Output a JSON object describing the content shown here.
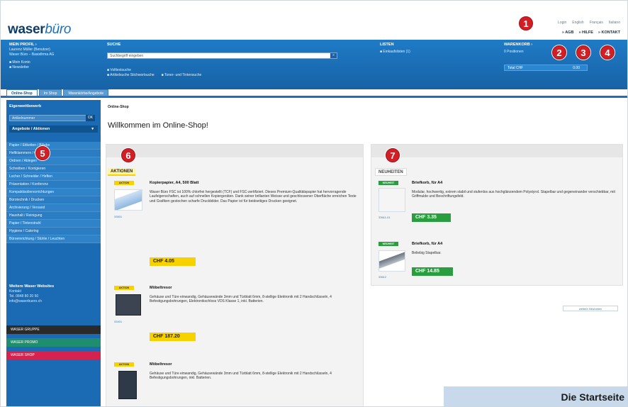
{
  "header": {
    "logo_a": "waser",
    "logo_b": "büro",
    "lang_links": [
      "Login",
      "English",
      "Français",
      "Italiano"
    ],
    "util_links": [
      "AGB",
      "HILFE",
      "KONTAKT"
    ]
  },
  "markers": [
    "1",
    "2",
    "3",
    "4",
    "5",
    "6",
    "7"
  ],
  "bluebar": {
    "profile_heading": "MEIN PROFIL",
    "profile_lines": [
      "Laurenz Müller (Benutzer)",
      "Waser Büro – Basisfirma AG"
    ],
    "profile_links": [
      "Mein Konto",
      "Newsletter"
    ],
    "search_heading": "SUCHE",
    "search_value": "Suchbegriff eingeben",
    "search_btn": "»",
    "search_options": [
      "Volltextsuche",
      "Artikelsuche Stichwortsuche",
      "Toner- und Tintensuche"
    ],
    "lists_heading": "LISTEN",
    "lists_item": "Einkaufslisten (1)",
    "cart_heading": "WARENKORB",
    "cart_line": "0 Positionen",
    "cart_total_label": "Total CHF",
    "cart_total_value": "0.00"
  },
  "tabs": [
    "Online-Shop",
    "Im Shop",
    "Warenkörbe/Angebote"
  ],
  "sidebar": {
    "search_heading": "Eigenwettbewerb",
    "search_placeholder": "Artikelnummer",
    "search_go": "OK",
    "category_heading": "Angebote / Aktionen",
    "categories": [
      "Papier / Etiketten / Blöcke",
      "Heftklammern / Ordner",
      "Ordnen / Ablegen",
      "Schreiben / Korrigieren",
      "Locher / Schneider / Heften",
      "Präsentation / Konferenz",
      "Kompaktisoliervorrichtungen",
      "Bürotechnik / Drucken",
      "Archivierung / Versand",
      "Haushalt / Reinigung",
      "Papier / Tintenstrahl",
      "Hygiene / Catering",
      "Büroeinrichtung / Stühle / Leuchten"
    ],
    "contact_heading": "Weitere Waser Websites",
    "contact_lines": [
      "Kontakt",
      "Tel. 0848 80 20 50",
      "info@waserbuero.ch"
    ],
    "btn_group": "WASER GRUPPE",
    "btn_promo": "WASER PROMO",
    "btn_shop": "WASER SHOP"
  },
  "content": {
    "breadcrumb": "Online-Shop",
    "welcome": "Willkommen im Online-Shop!",
    "aktionen_label": "AKTIONEN",
    "neuheiten_label": "NEUHEITEN",
    "aktionen": [
      {
        "tag": "AKTION",
        "title": "Kopierpapier, A4, 500 Blatt",
        "desc": "Waser Büro FSC ist 100% chlorfrei hergestellt (TCF) und FSC-zertifiziert. Dieses Premium-Qualitätspapier hat hervorragende Laufeigenschaften, auch auf schnellen Kopiergeräten. Dank seiner brillanten Weisse und geschlossener Oberfläche erreichen Texte und Grafiken gestochen scharfe Druckbilder. Das Papier ist für beidseitiges Drucken geeignet.",
        "artno": "33501",
        "price": "CHF 4.05"
      },
      {
        "tag": "AKTION",
        "title": "Möbeltresor",
        "desc": "Gehäuse und Türe einwandig, Gehäusewände 3mm und Türblatt 6mm, 8-stellige Elektronik mit 2 Handschlüsseln, 4 Befestigungsbohrungen, Elektronikschloss VDS Klasse 1, inkl. Batterien.",
        "artno": "33401",
        "price": "CHF 187.20"
      },
      {
        "tag": "AKTION",
        "title": "Möbeltresor",
        "desc": "Gehäuse und Türe einwandig, Gehäusewände 3mm und Türblatt 6mm, 8-stellige Elektronik mit 2 Handschlüsseln, 4 Befestigungsbohrungen, inkl. Batterien.",
        "artno": "33402",
        "price": ""
      }
    ],
    "neuheiten": [
      {
        "tag": "NEUHEIT",
        "title": "Briefkorb, für A4",
        "desc": "Modular, hochwertig, extrem stabil und stufenlos aus hochglänzendem Polystyrol. Stapelbar und gegeneinander verschiebbar, mit Griffmulde und Beschriftungsfeld.",
        "artno": "33611-01",
        "price": "CHF 3.35"
      },
      {
        "tag": "NEUHEIT",
        "title": "Briefkorb, für A4",
        "desc": "Beliebig Stapelbar.",
        "artno": "33612",
        "price": "CHF 14.85"
      }
    ],
    "more_btn": "weitere Neuheiten"
  },
  "caption": "Die Startseite"
}
